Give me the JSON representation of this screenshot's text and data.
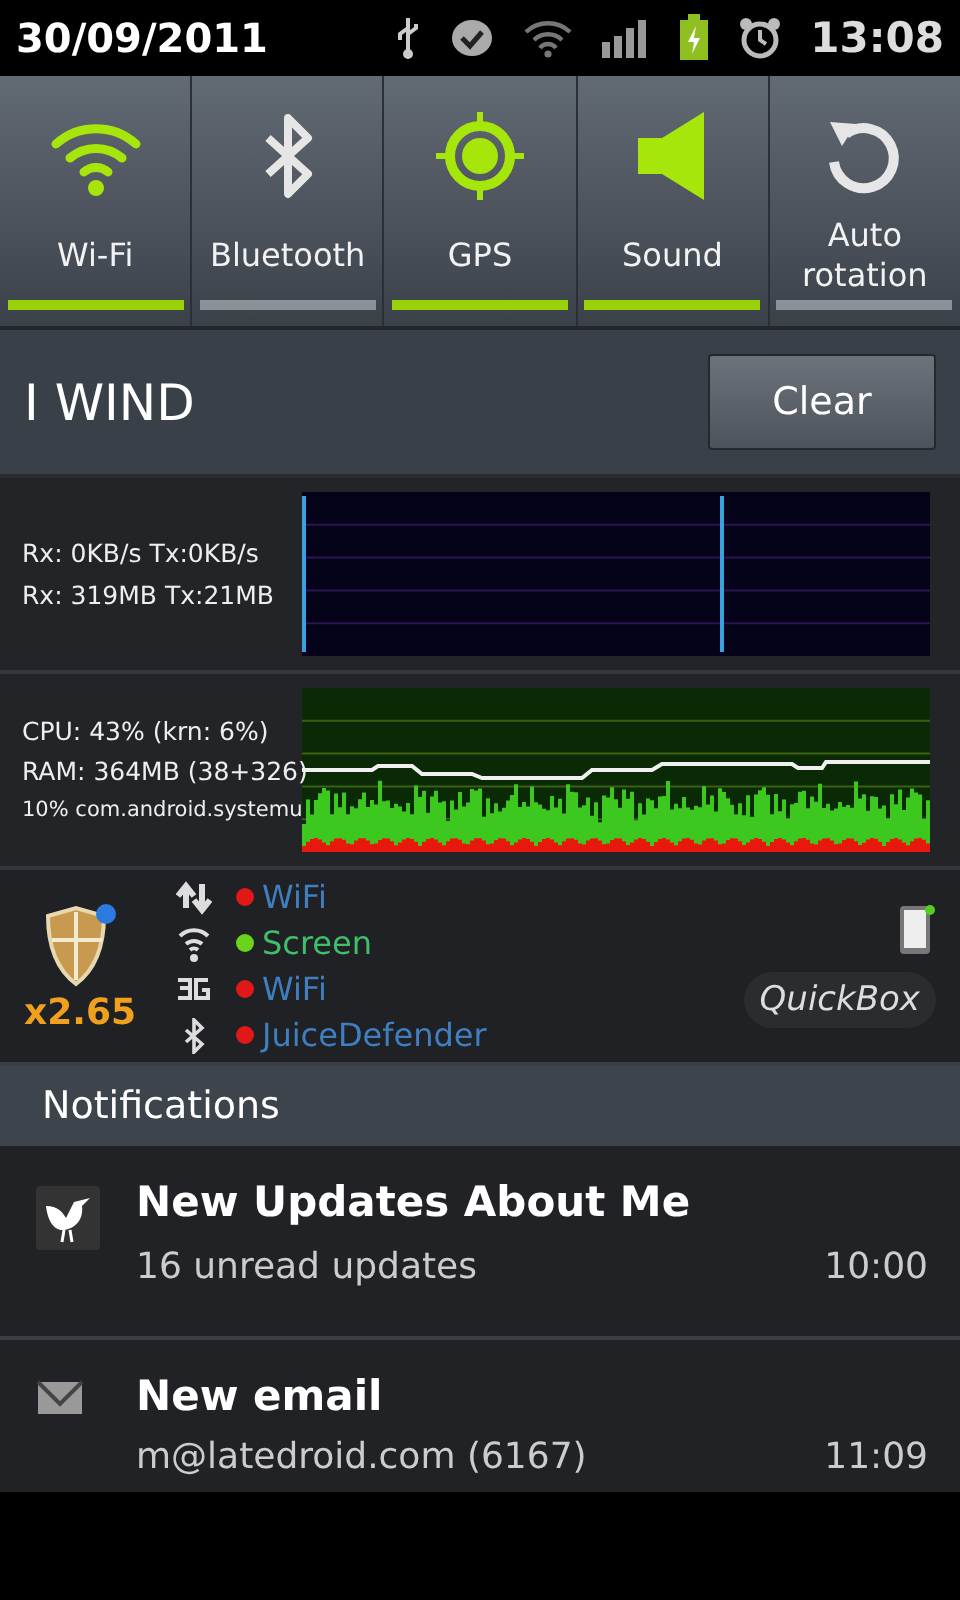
{
  "status_bar": {
    "date": "30/09/2011",
    "time": "13:08"
  },
  "toggles": [
    {
      "kind": "wifi",
      "label": "Wi-Fi",
      "on": true
    },
    {
      "kind": "bluetooth",
      "label": "Bluetooth",
      "on": false
    },
    {
      "kind": "gps",
      "label": "GPS",
      "on": true
    },
    {
      "kind": "sound",
      "label": "Sound",
      "on": true
    },
    {
      "kind": "rotation",
      "label": "Auto\nrotation",
      "on": false
    }
  ],
  "carrier": {
    "name": "I WIND",
    "clear_button": "Clear"
  },
  "network_widget": {
    "lines": [
      "Rx: 0KB/s Tx:0KB/s",
      "Rx: 319MB Tx:21MB"
    ]
  },
  "cpu_widget": {
    "lines": [
      "CPU: 43% (krn: 6%)",
      "RAM: 364MB (38+326)",
      "10% com.android.systemu"
    ]
  },
  "juice_defender": {
    "multiplier": "x2.65",
    "rows": [
      {
        "kind": "data",
        "label": "WiFi",
        "on": false
      },
      {
        "kind": "wifi",
        "label": "Screen",
        "on": true
      },
      {
        "kind": "cellular",
        "label": "WiFi",
        "on": false
      },
      {
        "kind": "bluetooth",
        "label": "JuiceDefender",
        "on": false
      }
    ],
    "quickbox": "QuickBox"
  },
  "notifications": {
    "title": "Notifications",
    "items": [
      {
        "kind": "bird",
        "title": "New Updates About Me",
        "text": "16 unread updates",
        "time": "10:00"
      },
      {
        "kind": "mail",
        "title": "New email",
        "text": "m@latedroid.com (6167)",
        "time": "11:09"
      }
    ]
  }
}
